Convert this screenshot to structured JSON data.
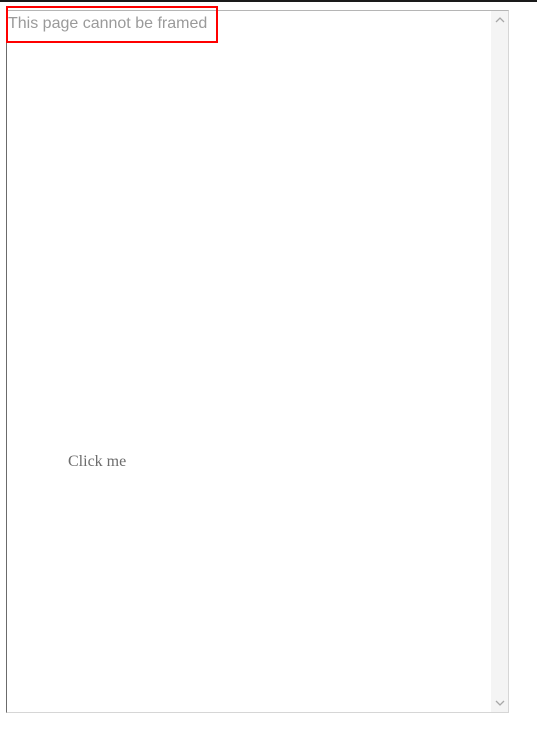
{
  "frame": {
    "message": "This page cannot be framed",
    "link_label": "Click me"
  },
  "scrollbar": {
    "up_icon": "chevron-up-icon",
    "down_icon": "chevron-down-icon"
  },
  "colors": {
    "highlight": "#ff0000",
    "message_text": "#9a9a9a",
    "link_text": "#6d6d6d",
    "scrollbar_track": "#f4f4f4"
  }
}
